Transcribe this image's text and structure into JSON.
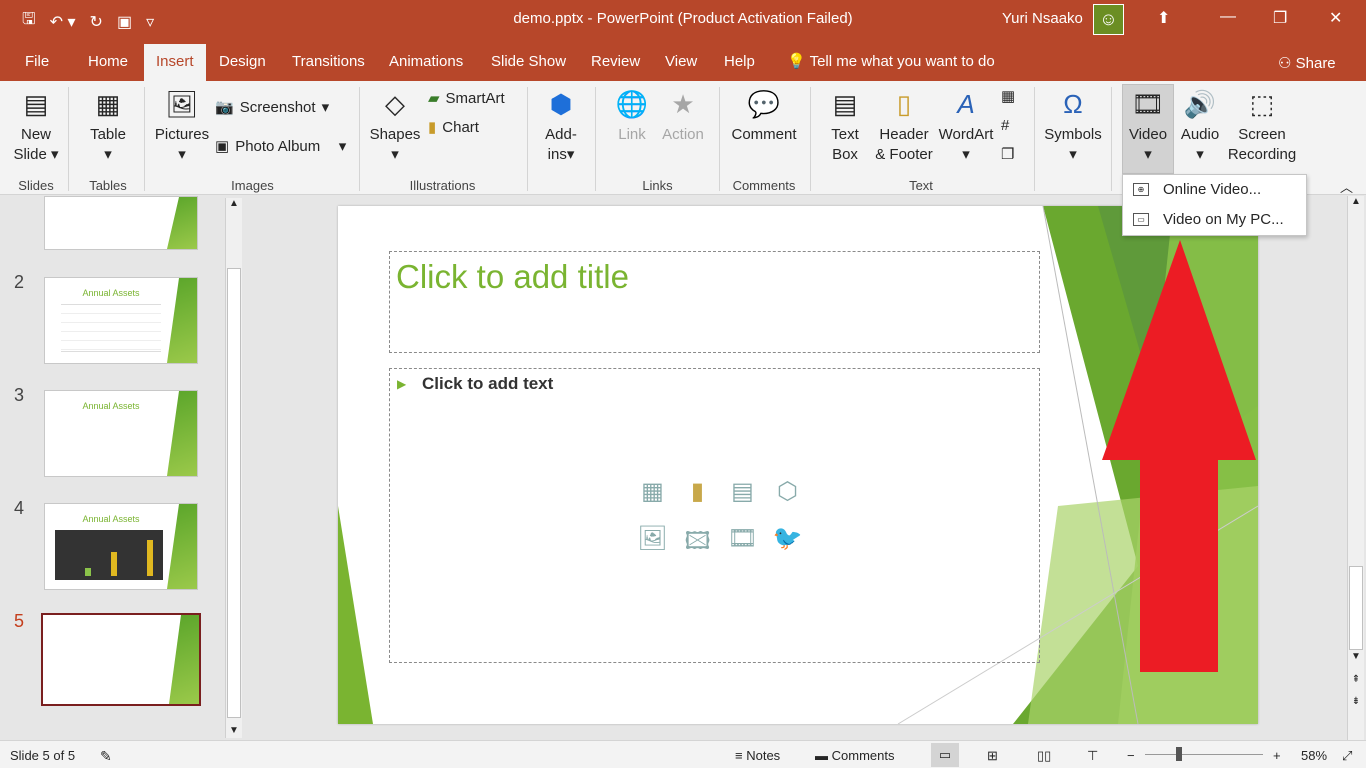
{
  "titlebar": {
    "doc_title": "demo.pptx  -  PowerPoint (Product Activation Failed)",
    "user": "Yuri Nsaako",
    "qat_icons": [
      "save-icon",
      "undo-icon",
      "redo-icon",
      "present-icon",
      "customize-icon"
    ]
  },
  "tabs": [
    "File",
    "Home",
    "Insert",
    "Design",
    "Transitions",
    "Animations",
    "Slide Show",
    "Review",
    "View",
    "Help"
  ],
  "active_tab": "Insert",
  "tell_me": "Tell me what you want to do",
  "share": "Share",
  "ribbon": {
    "new_slide": [
      "New",
      "Slide"
    ],
    "table": "Table",
    "pictures": "Pictures",
    "screenshot": "Screenshot",
    "photo_album": "Photo Album",
    "shapes": "Shapes",
    "smartart": "SmartArt",
    "chart": "Chart",
    "addins": [
      "Add-",
      "ins"
    ],
    "link": "Link",
    "action": "Action",
    "comment": "Comment",
    "textbox": [
      "Text",
      "Box"
    ],
    "header_footer": [
      "Header",
      "& Footer"
    ],
    "wordart": "WordArt",
    "symbols": "Symbols",
    "video": "Video",
    "audio": "Audio",
    "screen_recording": [
      "Screen",
      "Recording"
    ],
    "groups": {
      "slides": "Slides",
      "tables": "Tables",
      "images": "Images",
      "illustrations": "Illustrations",
      "links": "Links",
      "comments": "Comments",
      "text": "Text"
    }
  },
  "video_menu": [
    "Online Video...",
    "Video on My PC..."
  ],
  "slides": [
    {
      "num": "",
      "title": ""
    },
    {
      "num": "2",
      "title": "Annual Assets"
    },
    {
      "num": "3",
      "title": "Annual Assets"
    },
    {
      "num": "4",
      "title": "Annual Assets"
    },
    {
      "num": "5",
      "title": ""
    }
  ],
  "slide": {
    "title_placeholder": "Click to add title",
    "body_placeholder": "Click to add text"
  },
  "status": {
    "slide_info": "Slide 5 of 5",
    "notes": "Notes",
    "comments": "Comments",
    "zoom": "58%"
  },
  "colors": {
    "accent": "#b7472a",
    "slide_green": "#7ab431",
    "arrow_red": "#ec1c24"
  }
}
